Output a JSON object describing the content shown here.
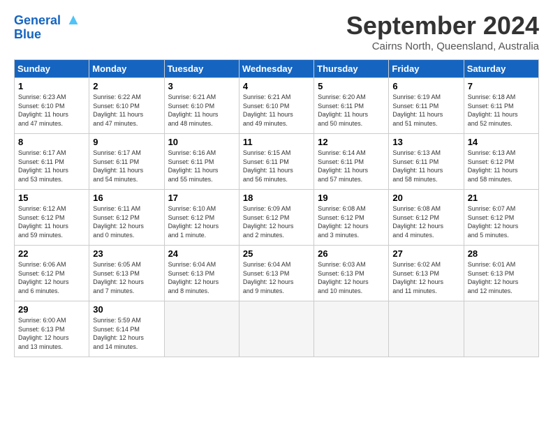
{
  "logo": {
    "line1": "General",
    "line2": "Blue"
  },
  "title": "September 2024",
  "location": "Cairns North, Queensland, Australia",
  "headers": [
    "Sunday",
    "Monday",
    "Tuesday",
    "Wednesday",
    "Thursday",
    "Friday",
    "Saturday"
  ],
  "weeks": [
    [
      {
        "day": "1",
        "info": "Sunrise: 6:23 AM\nSunset: 6:10 PM\nDaylight: 11 hours\nand 47 minutes."
      },
      {
        "day": "2",
        "info": "Sunrise: 6:22 AM\nSunset: 6:10 PM\nDaylight: 11 hours\nand 47 minutes."
      },
      {
        "day": "3",
        "info": "Sunrise: 6:21 AM\nSunset: 6:10 PM\nDaylight: 11 hours\nand 48 minutes."
      },
      {
        "day": "4",
        "info": "Sunrise: 6:21 AM\nSunset: 6:10 PM\nDaylight: 11 hours\nand 49 minutes."
      },
      {
        "day": "5",
        "info": "Sunrise: 6:20 AM\nSunset: 6:11 PM\nDaylight: 11 hours\nand 50 minutes."
      },
      {
        "day": "6",
        "info": "Sunrise: 6:19 AM\nSunset: 6:11 PM\nDaylight: 11 hours\nand 51 minutes."
      },
      {
        "day": "7",
        "info": "Sunrise: 6:18 AM\nSunset: 6:11 PM\nDaylight: 11 hours\nand 52 minutes."
      }
    ],
    [
      {
        "day": "8",
        "info": "Sunrise: 6:17 AM\nSunset: 6:11 PM\nDaylight: 11 hours\nand 53 minutes."
      },
      {
        "day": "9",
        "info": "Sunrise: 6:17 AM\nSunset: 6:11 PM\nDaylight: 11 hours\nand 54 minutes."
      },
      {
        "day": "10",
        "info": "Sunrise: 6:16 AM\nSunset: 6:11 PM\nDaylight: 11 hours\nand 55 minutes."
      },
      {
        "day": "11",
        "info": "Sunrise: 6:15 AM\nSunset: 6:11 PM\nDaylight: 11 hours\nand 56 minutes."
      },
      {
        "day": "12",
        "info": "Sunrise: 6:14 AM\nSunset: 6:11 PM\nDaylight: 11 hours\nand 57 minutes."
      },
      {
        "day": "13",
        "info": "Sunrise: 6:13 AM\nSunset: 6:11 PM\nDaylight: 11 hours\nand 58 minutes."
      },
      {
        "day": "14",
        "info": "Sunrise: 6:13 AM\nSunset: 6:12 PM\nDaylight: 11 hours\nand 58 minutes."
      }
    ],
    [
      {
        "day": "15",
        "info": "Sunrise: 6:12 AM\nSunset: 6:12 PM\nDaylight: 11 hours\nand 59 minutes."
      },
      {
        "day": "16",
        "info": "Sunrise: 6:11 AM\nSunset: 6:12 PM\nDaylight: 12 hours\nand 0 minutes."
      },
      {
        "day": "17",
        "info": "Sunrise: 6:10 AM\nSunset: 6:12 PM\nDaylight: 12 hours\nand 1 minute."
      },
      {
        "day": "18",
        "info": "Sunrise: 6:09 AM\nSunset: 6:12 PM\nDaylight: 12 hours\nand 2 minutes."
      },
      {
        "day": "19",
        "info": "Sunrise: 6:08 AM\nSunset: 6:12 PM\nDaylight: 12 hours\nand 3 minutes."
      },
      {
        "day": "20",
        "info": "Sunrise: 6:08 AM\nSunset: 6:12 PM\nDaylight: 12 hours\nand 4 minutes."
      },
      {
        "day": "21",
        "info": "Sunrise: 6:07 AM\nSunset: 6:12 PM\nDaylight: 12 hours\nand 5 minutes."
      }
    ],
    [
      {
        "day": "22",
        "info": "Sunrise: 6:06 AM\nSunset: 6:12 PM\nDaylight: 12 hours\nand 6 minutes."
      },
      {
        "day": "23",
        "info": "Sunrise: 6:05 AM\nSunset: 6:13 PM\nDaylight: 12 hours\nand 7 minutes."
      },
      {
        "day": "24",
        "info": "Sunrise: 6:04 AM\nSunset: 6:13 PM\nDaylight: 12 hours\nand 8 minutes."
      },
      {
        "day": "25",
        "info": "Sunrise: 6:04 AM\nSunset: 6:13 PM\nDaylight: 12 hours\nand 9 minutes."
      },
      {
        "day": "26",
        "info": "Sunrise: 6:03 AM\nSunset: 6:13 PM\nDaylight: 12 hours\nand 10 minutes."
      },
      {
        "day": "27",
        "info": "Sunrise: 6:02 AM\nSunset: 6:13 PM\nDaylight: 12 hours\nand 11 minutes."
      },
      {
        "day": "28",
        "info": "Sunrise: 6:01 AM\nSunset: 6:13 PM\nDaylight: 12 hours\nand 12 minutes."
      }
    ],
    [
      {
        "day": "29",
        "info": "Sunrise: 6:00 AM\nSunset: 6:13 PM\nDaylight: 12 hours\nand 13 minutes."
      },
      {
        "day": "30",
        "info": "Sunrise: 5:59 AM\nSunset: 6:14 PM\nDaylight: 12 hours\nand 14 minutes."
      },
      {
        "day": "",
        "info": ""
      },
      {
        "day": "",
        "info": ""
      },
      {
        "day": "",
        "info": ""
      },
      {
        "day": "",
        "info": ""
      },
      {
        "day": "",
        "info": ""
      }
    ]
  ]
}
